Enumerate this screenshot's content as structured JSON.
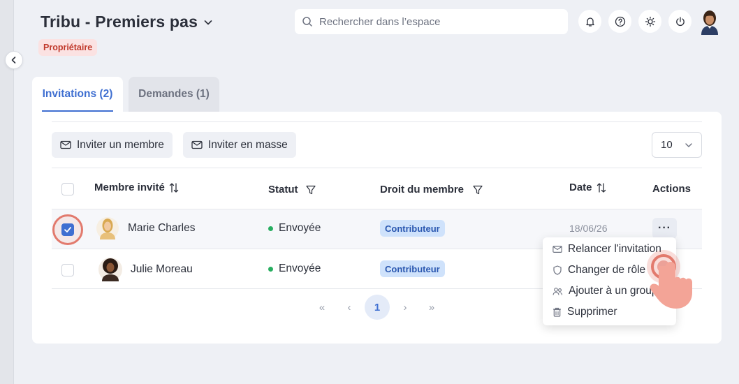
{
  "header": {
    "title": "Tribu - Premiers pas",
    "role_badge": "Propriétaire",
    "search_placeholder": "Rechercher dans l’espace",
    "icons": [
      "bell-icon",
      "help-icon",
      "sun-icon",
      "power-icon"
    ]
  },
  "tabs": [
    {
      "label": "Invitations (2)",
      "active": true
    },
    {
      "label": "Demandes (1)",
      "active": false
    }
  ],
  "toolbar": {
    "invite_member": "Inviter un membre",
    "invite_bulk": "Inviter en masse",
    "page_size": "10"
  },
  "table": {
    "columns": [
      "Membre invité",
      "Statut",
      "Droit du membre",
      "Date",
      "Actions"
    ],
    "rows": [
      {
        "name": "Marie Charles",
        "status": "Envoyée",
        "role": "Contributeur",
        "date": "18/06/26",
        "checked": true
      },
      {
        "name": "Julie Moreau",
        "status": "Envoyée",
        "role": "Contributeur",
        "date": "",
        "checked": false
      }
    ],
    "actions_glyph": "···"
  },
  "pagination": {
    "first": "«",
    "prev": "‹",
    "current": "1",
    "next": "›",
    "last": "»"
  },
  "context_menu": {
    "items": [
      {
        "label": "Relancer l'invitation",
        "icon": "mail-icon"
      },
      {
        "label": "Changer de rôle",
        "icon": "shield-icon"
      },
      {
        "label": "Ajouter à un groupe",
        "icon": "users-icon"
      },
      {
        "label": "Supprimer",
        "icon": "trash-icon"
      }
    ]
  },
  "colors": {
    "accent": "#3f6fd1",
    "background": "#eef0f5",
    "owner_badge_bg": "#fbe2e2",
    "owner_badge_text": "#c0392b",
    "role_badge_bg": "#cfe2fb",
    "status_green": "#27ae60",
    "highlight": "#e27a6d"
  }
}
